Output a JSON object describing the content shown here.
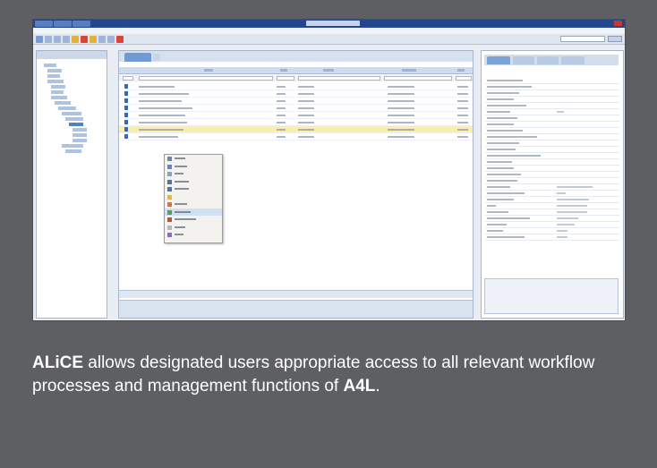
{
  "screenshot": {
    "colors": {
      "titlebar": "#24468e",
      "selection": "#fbeeaa",
      "panel": "#e9edf3"
    }
  },
  "caption": {
    "brand": "ALiCE",
    "text_before": " allows designated users appropriate access to all relevant workflow processes and management functions of ",
    "product": "A4L",
    "text_after": "."
  },
  "colors": {
    "background": "#5d5f63",
    "caption_text": "#ffffff"
  }
}
